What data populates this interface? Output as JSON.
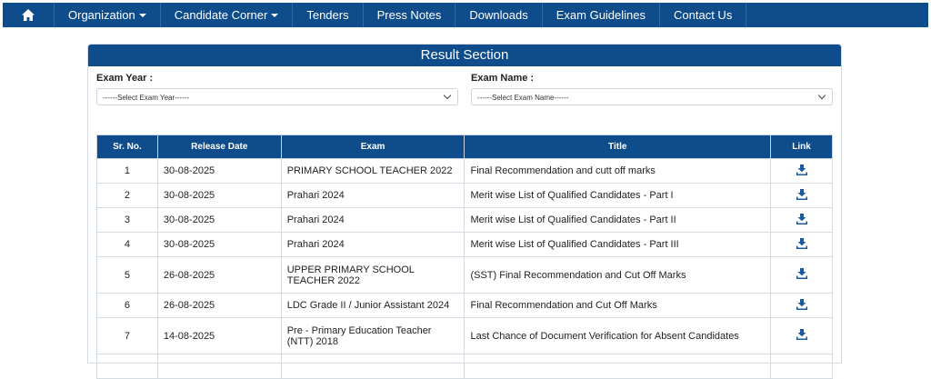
{
  "nav": {
    "items": [
      {
        "label": "Organization",
        "dropdown": true
      },
      {
        "label": "Candidate Corner",
        "dropdown": true
      },
      {
        "label": "Tenders",
        "dropdown": false
      },
      {
        "label": "Press Notes",
        "dropdown": false
      },
      {
        "label": "Downloads",
        "dropdown": false
      },
      {
        "label": "Exam Guidelines",
        "dropdown": false
      },
      {
        "label": "Contact Us",
        "dropdown": false
      }
    ]
  },
  "panel": {
    "title": "Result Section",
    "exam_year_label": "Exam Year :",
    "exam_year_value": "------Select Exam Year------",
    "exam_name_label": "Exam Name :",
    "exam_name_value": "------Select Exam Name------"
  },
  "table": {
    "headers": [
      "Sr. No.",
      "Release Date",
      "Exam",
      "Title",
      "Link"
    ],
    "rows": [
      {
        "sr": "1",
        "date": "30-08-2025",
        "exam": "PRIMARY SCHOOL TEACHER 2022",
        "title": "Final Recommendation and cutt off marks"
      },
      {
        "sr": "2",
        "date": "30-08-2025",
        "exam": "Prahari 2024",
        "title": "Merit wise List of Qualified Candidates - Part I"
      },
      {
        "sr": "3",
        "date": "30-08-2025",
        "exam": "Prahari 2024",
        "title": "Merit wise List of Qualified Candidates - Part II"
      },
      {
        "sr": "4",
        "date": "30-08-2025",
        "exam": "Prahari 2024",
        "title": "Merit wise List of Qualified Candidates - Part III"
      },
      {
        "sr": "5",
        "date": "26-08-2025",
        "exam": "UPPER PRIMARY SCHOOL TEACHER 2022",
        "title": "(SST) Final Recommendation and Cut Off Marks"
      },
      {
        "sr": "6",
        "date": "26-08-2025",
        "exam": "LDC Grade II / Junior Assistant 2024",
        "title": "Final Recommendation and Cut Off Marks"
      },
      {
        "sr": "7",
        "date": "14-08-2025",
        "exam": "Pre - Primary Education Teacher (NTT) 2018",
        "title": "Last Chance of Document Verification for Absent Candidates"
      }
    ]
  },
  "colors": {
    "brand": "#0f4c8c",
    "icon": "#1a5aa0"
  }
}
